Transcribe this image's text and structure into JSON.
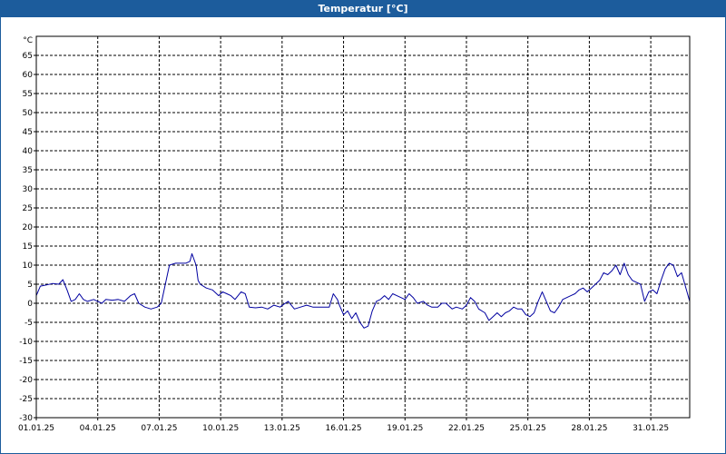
{
  "title": "Temperatur [°C]",
  "chart_data": {
    "type": "line",
    "title": "Temperatur [°C]",
    "ylabel": "°C",
    "xlabel": "",
    "ylim": [
      -30,
      70
    ],
    "yticks": [
      65,
      60,
      55,
      50,
      45,
      40,
      35,
      30,
      25,
      20,
      15,
      10,
      5,
      0,
      -5,
      -10,
      -15,
      -20,
      -25,
      -30
    ],
    "xticks": [
      "01.01.25",
      "04.01.25",
      "07.01.25",
      "10.01.25",
      "13.01.25",
      "16.01.25",
      "19.01.25",
      "22.01.25",
      "25.01.25",
      "28.01.25",
      "31.01.25"
    ],
    "grid": true,
    "line_color": "#0000a0",
    "x_units": "days since 01.01.25",
    "xlim": [
      0,
      31.9
    ],
    "series": [
      {
        "values": [
          [
            0.0,
            2.0
          ],
          [
            0.2,
            4.5
          ],
          [
            0.5,
            4.8
          ],
          [
            0.8,
            5.2
          ],
          [
            1.1,
            5.0
          ],
          [
            1.3,
            6.2
          ],
          [
            1.5,
            3.5
          ],
          [
            1.7,
            0.5
          ],
          [
            1.9,
            1.0
          ],
          [
            2.1,
            2.5
          ],
          [
            2.3,
            1.0
          ],
          [
            2.5,
            0.5
          ],
          [
            2.8,
            1.0
          ],
          [
            3.0,
            0.5
          ],
          [
            3.2,
            0.0
          ],
          [
            3.4,
            1.0
          ],
          [
            3.7,
            0.8
          ],
          [
            4.0,
            1.0
          ],
          [
            4.3,
            0.5
          ],
          [
            4.6,
            2.0
          ],
          [
            4.8,
            2.5
          ],
          [
            5.0,
            0.0
          ],
          [
            5.3,
            -1.0
          ],
          [
            5.6,
            -1.5
          ],
          [
            5.9,
            -1.0
          ],
          [
            6.1,
            0.0
          ],
          [
            6.3,
            5.0
          ],
          [
            6.5,
            10.0
          ],
          [
            6.8,
            10.5
          ],
          [
            7.0,
            10.5
          ],
          [
            7.3,
            10.5
          ],
          [
            7.5,
            11.0
          ],
          [
            7.6,
            13.0
          ],
          [
            7.8,
            10.0
          ],
          [
            7.9,
            6.0
          ],
          [
            8.0,
            5.0
          ],
          [
            8.3,
            4.0
          ],
          [
            8.6,
            3.5
          ],
          [
            8.9,
            2.0
          ],
          [
            9.1,
            3.0
          ],
          [
            9.3,
            2.5
          ],
          [
            9.5,
            2.0
          ],
          [
            9.7,
            1.0
          ],
          [
            10.0,
            3.0
          ],
          [
            10.2,
            2.5
          ],
          [
            10.4,
            -1.0
          ],
          [
            10.7,
            -1.2
          ],
          [
            11.0,
            -1.0
          ],
          [
            11.3,
            -1.5
          ],
          [
            11.6,
            -0.5
          ],
          [
            11.9,
            -1.0
          ],
          [
            12.1,
            -0.2
          ],
          [
            12.3,
            0.5
          ],
          [
            12.6,
            -1.5
          ],
          [
            12.9,
            -1.0
          ],
          [
            13.2,
            -0.5
          ],
          [
            13.5,
            -1.0
          ],
          [
            13.8,
            -1.0
          ],
          [
            14.1,
            -1.0
          ],
          [
            14.3,
            -1.0
          ],
          [
            14.5,
            2.5
          ],
          [
            14.7,
            1.0
          ],
          [
            14.8,
            -0.5
          ],
          [
            15.0,
            -3.0
          ],
          [
            15.2,
            -2.0
          ],
          [
            15.4,
            -4.0
          ],
          [
            15.6,
            -2.5
          ],
          [
            15.8,
            -5.0
          ],
          [
            16.0,
            -6.5
          ],
          [
            16.2,
            -6.0
          ],
          [
            16.4,
            -2.0
          ],
          [
            16.6,
            0.5
          ],
          [
            16.8,
            1.0
          ],
          [
            17.0,
            2.0
          ],
          [
            17.2,
            1.0
          ],
          [
            17.4,
            2.5
          ],
          [
            17.6,
            2.0
          ],
          [
            17.8,
            1.5
          ],
          [
            18.0,
            1.0
          ],
          [
            18.2,
            2.5
          ],
          [
            18.4,
            1.5
          ],
          [
            18.6,
            0.0
          ],
          [
            18.9,
            0.5
          ],
          [
            19.1,
            -0.5
          ],
          [
            19.3,
            -1.0
          ],
          [
            19.6,
            -1.0
          ],
          [
            19.8,
            0.0
          ],
          [
            20.0,
            0.0
          ],
          [
            20.3,
            -1.5
          ],
          [
            20.5,
            -1.0
          ],
          [
            20.8,
            -1.5
          ],
          [
            21.0,
            -0.5
          ],
          [
            21.2,
            1.5
          ],
          [
            21.4,
            0.5
          ],
          [
            21.6,
            -1.5
          ],
          [
            21.9,
            -2.5
          ],
          [
            22.1,
            -4.5
          ],
          [
            22.3,
            -3.5
          ],
          [
            22.5,
            -2.5
          ],
          [
            22.7,
            -3.5
          ],
          [
            22.9,
            -2.5
          ],
          [
            23.1,
            -2.0
          ],
          [
            23.3,
            -1.0
          ],
          [
            23.5,
            -1.5
          ],
          [
            23.7,
            -1.5
          ],
          [
            23.9,
            -3.0
          ],
          [
            24.1,
            -3.5
          ],
          [
            24.3,
            -2.5
          ],
          [
            24.5,
            0.5
          ],
          [
            24.7,
            3.0
          ],
          [
            24.9,
            0.5
          ],
          [
            25.1,
            -2.0
          ],
          [
            25.3,
            -2.5
          ],
          [
            25.5,
            -1.0
          ],
          [
            25.7,
            1.0
          ],
          [
            25.9,
            1.5
          ],
          [
            26.1,
            2.0
          ],
          [
            26.3,
            2.5
          ],
          [
            26.5,
            3.5
          ],
          [
            26.7,
            4.0
          ],
          [
            26.9,
            3.0
          ],
          [
            27.1,
            4.0
          ],
          [
            27.3,
            5.0
          ],
          [
            27.5,
            6.0
          ],
          [
            27.7,
            8.0
          ],
          [
            27.9,
            7.5
          ],
          [
            28.1,
            8.5
          ],
          [
            28.3,
            10.0
          ],
          [
            28.5,
            7.5
          ],
          [
            28.7,
            10.5
          ],
          [
            28.9,
            7.5
          ],
          [
            29.1,
            6.0
          ],
          [
            29.3,
            5.5
          ],
          [
            29.5,
            5.0
          ],
          [
            29.7,
            0.5
          ],
          [
            29.9,
            3.0
          ],
          [
            30.1,
            3.5
          ],
          [
            30.3,
            2.5
          ],
          [
            30.5,
            6.0
          ],
          [
            30.7,
            9.0
          ],
          [
            30.9,
            10.5
          ],
          [
            31.1,
            10.0
          ],
          [
            31.3,
            7.0
          ],
          [
            31.5,
            8.0
          ],
          [
            31.9,
            0.5
          ]
        ]
      }
    ]
  }
}
